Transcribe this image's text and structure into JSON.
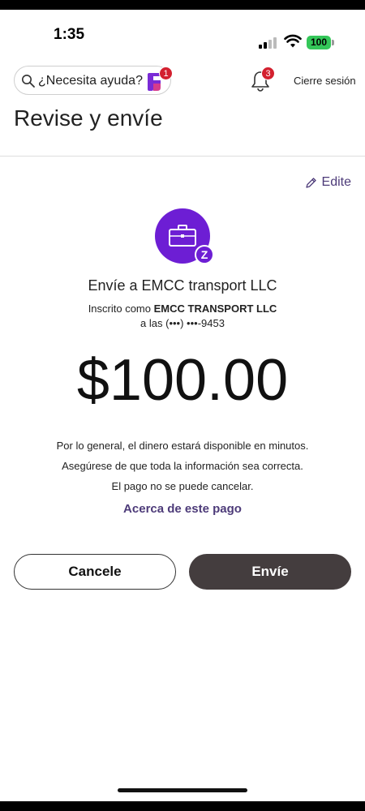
{
  "status_bar": {
    "time": "1:35",
    "battery": "100"
  },
  "header": {
    "search_placeholder": "¿Necesita ayuda?",
    "search_badge": "1",
    "notifications_badge": "3",
    "signout_label": "Cierre sesión"
  },
  "page": {
    "title": "Revise y envíe",
    "edit_label": "Edite"
  },
  "recipient": {
    "send_to": "Envíe a EMCC transport LLC",
    "enrolled_prefix": "Inscrito como",
    "enrolled_name": "EMCC TRANSPORT LLC",
    "phone": "a las (•••) •••-9453",
    "zelle_mark": "Z"
  },
  "payment": {
    "amount": "$100.00",
    "info_line1": "Por lo general, el dinero estará disponible en minutos.",
    "info_line2": "Asegúrese de que toda la información sea correcta.",
    "info_line3": "El pago no se puede cancelar.",
    "about_link": "Acerca de este pago"
  },
  "actions": {
    "cancel_label": "Cancele",
    "send_label": "Envíe"
  },
  "colors": {
    "brand_purple": "#6d1ed4",
    "link_purple": "#4d3b79",
    "send_button": "#443d3e",
    "badge_red": "#d3202f"
  },
  "icons": [
    "search-icon",
    "zelle-app-icon",
    "bell-icon",
    "pencil-icon",
    "briefcase-icon",
    "zelle-badge-icon"
  ]
}
